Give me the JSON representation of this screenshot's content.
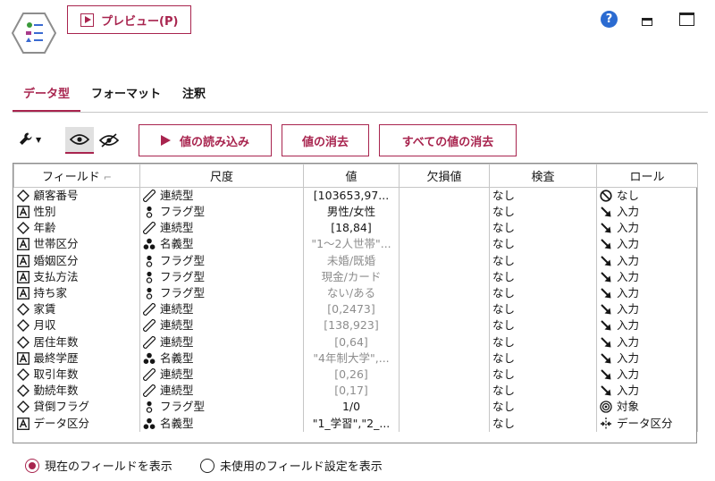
{
  "toolbar": {
    "preview_label": "プレビュー(P)",
    "help_glyph": "?"
  },
  "tabs": [
    {
      "label": "データ型",
      "active": true
    },
    {
      "label": "フォーマット",
      "active": false
    },
    {
      "label": "注釈",
      "active": false
    }
  ],
  "actions": {
    "read_values": "値の読み込み",
    "clear_values": "値の消去",
    "clear_all_values": "すべての値の消去"
  },
  "columns": [
    "フィールド",
    "尺度",
    "値",
    "欠損値",
    "検査",
    "ロール"
  ],
  "sort_glyph": "⌐",
  "rows": [
    {
      "field_icon": "diamond-icon",
      "field": "顧客番号",
      "measure_icon": "ruler-icon",
      "measure": "連続型",
      "value": "[103653,97...",
      "dim": false,
      "missing": "",
      "check": "なし",
      "role_icon": "none-icon",
      "role": "なし"
    },
    {
      "field_icon": "text-a-icon",
      "field": "性別",
      "measure_icon": "flag-icon",
      "measure": "フラグ型",
      "value": "男性/女性",
      "dim": false,
      "missing": "",
      "check": "なし",
      "role_icon": "arrow-icon",
      "role": "入力"
    },
    {
      "field_icon": "diamond-icon",
      "field": "年齢",
      "measure_icon": "ruler-icon",
      "measure": "連続型",
      "value": "[18,84]",
      "dim": false,
      "missing": "",
      "check": "なし",
      "role_icon": "arrow-icon",
      "role": "入力"
    },
    {
      "field_icon": "text-a-icon",
      "field": "世帯区分",
      "measure_icon": "nominal-icon",
      "measure": "名義型",
      "value": "\"1～2人世帯\"...",
      "dim": true,
      "missing": "",
      "check": "なし",
      "role_icon": "arrow-icon",
      "role": "入力"
    },
    {
      "field_icon": "text-a-icon",
      "field": "婚姻区分",
      "measure_icon": "flag-icon",
      "measure": "フラグ型",
      "value": "未婚/既婚",
      "dim": true,
      "missing": "",
      "check": "なし",
      "role_icon": "arrow-icon",
      "role": "入力"
    },
    {
      "field_icon": "text-a-icon",
      "field": "支払方法",
      "measure_icon": "flag-icon",
      "measure": "フラグ型",
      "value": "現金/カード",
      "dim": true,
      "missing": "",
      "check": "なし",
      "role_icon": "arrow-icon",
      "role": "入力"
    },
    {
      "field_icon": "text-a-icon",
      "field": "持ち家",
      "measure_icon": "flag-icon",
      "measure": "フラグ型",
      "value": "ない/ある",
      "dim": true,
      "missing": "",
      "check": "なし",
      "role_icon": "arrow-icon",
      "role": "入力"
    },
    {
      "field_icon": "diamond-icon",
      "field": "家賃",
      "measure_icon": "ruler-icon",
      "measure": "連続型",
      "value": "[0,2473]",
      "dim": true,
      "missing": "",
      "check": "なし",
      "role_icon": "arrow-icon",
      "role": "入力"
    },
    {
      "field_icon": "diamond-icon",
      "field": "月収",
      "measure_icon": "ruler-icon",
      "measure": "連続型",
      "value": "[138,923]",
      "dim": true,
      "missing": "",
      "check": "なし",
      "role_icon": "arrow-icon",
      "role": "入力"
    },
    {
      "field_icon": "diamond-icon",
      "field": "居住年数",
      "measure_icon": "ruler-icon",
      "measure": "連続型",
      "value": "[0,64]",
      "dim": true,
      "missing": "",
      "check": "なし",
      "role_icon": "arrow-icon",
      "role": "入力"
    },
    {
      "field_icon": "text-a-icon",
      "field": "最終学歴",
      "measure_icon": "nominal-icon",
      "measure": "名義型",
      "value": "\"4年制大学\",...",
      "dim": true,
      "missing": "",
      "check": "なし",
      "role_icon": "arrow-icon",
      "role": "入力"
    },
    {
      "field_icon": "diamond-icon",
      "field": "取引年数",
      "measure_icon": "ruler-icon",
      "measure": "連続型",
      "value": "[0,26]",
      "dim": true,
      "missing": "",
      "check": "なし",
      "role_icon": "arrow-icon",
      "role": "入力"
    },
    {
      "field_icon": "diamond-icon",
      "field": "勤続年数",
      "measure_icon": "ruler-icon",
      "measure": "連続型",
      "value": "[0,17]",
      "dim": true,
      "missing": "",
      "check": "なし",
      "role_icon": "arrow-icon",
      "role": "入力"
    },
    {
      "field_icon": "diamond-icon",
      "field": "貸倒フラグ",
      "measure_icon": "flag-icon",
      "measure": "フラグ型",
      "value": "1/0",
      "dim": false,
      "missing": "",
      "check": "なし",
      "role_icon": "target-icon",
      "role": "対象"
    },
    {
      "field_icon": "text-a-icon",
      "field": "データ区分",
      "measure_icon": "nominal-icon",
      "measure": "名義型",
      "value": "\"1_学習\",\"2_...",
      "dim": false,
      "missing": "",
      "check": "なし",
      "role_icon": "split-icon",
      "role": "データ区分"
    }
  ],
  "radios": [
    {
      "label": "現在のフィールドを表示",
      "checked": true
    },
    {
      "label": "未使用のフィールド設定を表示",
      "checked": false
    }
  ],
  "colors": {
    "accent": "#a8244e",
    "help": "#2b6bd1"
  }
}
